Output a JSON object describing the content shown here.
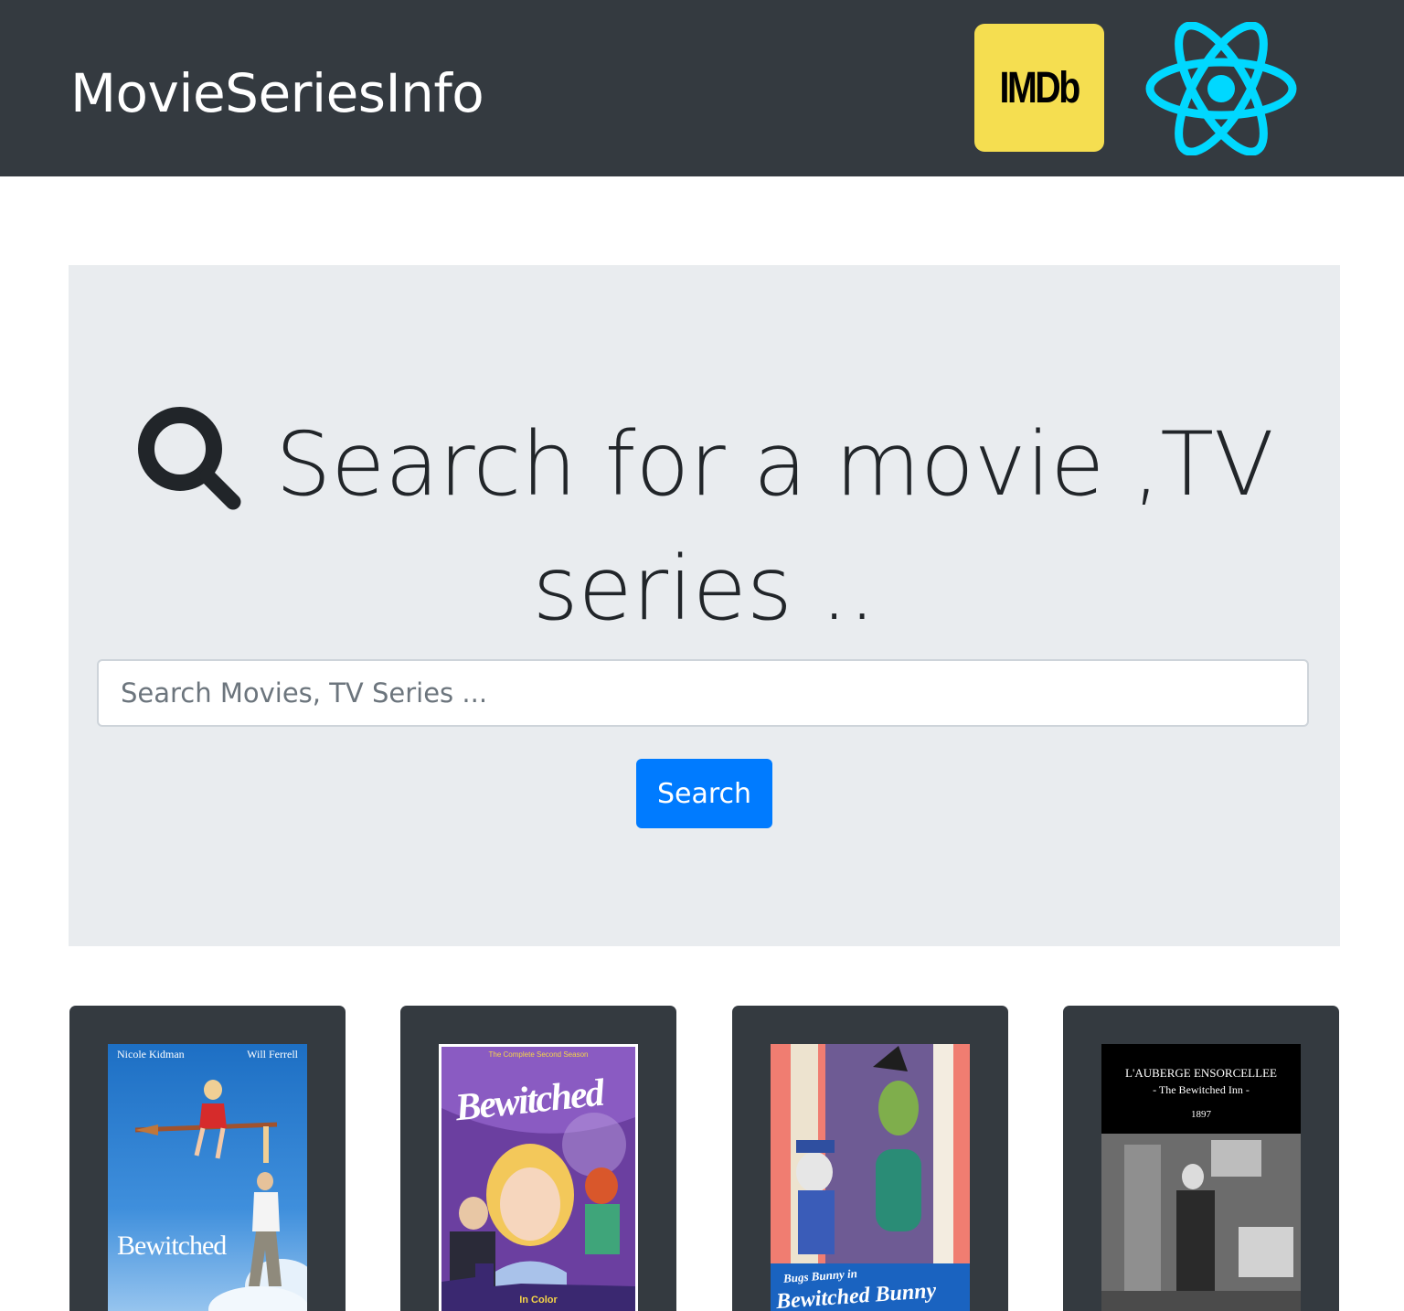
{
  "navbar": {
    "brand": "MovieSeriesInfo",
    "imdb_logo_text": "IMDb",
    "react_logo_icon": "react-atom-icon"
  },
  "hero": {
    "icon": "search-icon",
    "headline_line1": "Search for a movie ,TV",
    "headline_line2": "series ..",
    "search_placeholder": "Search Movies, TV Series ...",
    "search_value": "",
    "search_button_label": "Search",
    "accent_color": "#007bff"
  },
  "results": [
    {
      "poster_texts": {
        "actor_left": "Nicole Kidman",
        "actor_right": "Will Ferrell",
        "title": "Bewitched"
      }
    },
    {
      "poster_texts": {
        "tagline": "The Complete Second Season",
        "title": "Bewitched",
        "badge": "In Color"
      }
    },
    {
      "poster_texts": {
        "line1": "Bugs Bunny in",
        "title": "Bewitched Bunny"
      }
    },
    {
      "poster_texts": {
        "title": "L'AUBERGE ENSORCELLEE",
        "subtitle": "- The Bewitched Inn -",
        "year": "1897"
      }
    }
  ],
  "colors": {
    "navbar_bg": "#343a40",
    "jumbotron_bg": "#e9ecef",
    "imdb_yellow": "#f5de50",
    "react_cyan": "#00d8ff"
  }
}
